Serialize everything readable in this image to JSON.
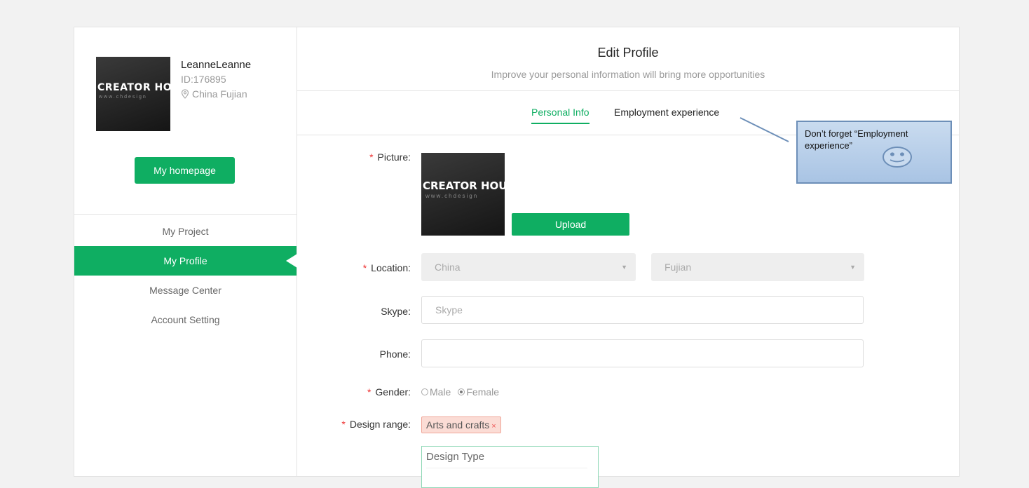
{
  "user": {
    "name": "LeanneLeanne",
    "id": "ID:176895",
    "location": "China Fujian",
    "avatar_brand": "CREATOR HOU",
    "avatar_sub": "www.chdesign"
  },
  "sidebar": {
    "homepage_label": "My homepage",
    "items": [
      {
        "label": "My Project"
      },
      {
        "label": "My Profile"
      },
      {
        "label": "Message Center"
      },
      {
        "label": "Account Setting"
      }
    ]
  },
  "main": {
    "title": "Edit Profile",
    "subtitle": "Improve your personal information will bring more opportunities",
    "tabs": [
      {
        "label": "Personal Info"
      },
      {
        "label": "Employment experience"
      }
    ]
  },
  "form": {
    "picture_label": "Picture:",
    "picture_brand": "CREATOR HOU",
    "picture_sub": "www.chdesign",
    "upload_label": "Upload",
    "location_label": "Location:",
    "country_value": "China",
    "province_value": "Fujian",
    "skype_label": "Skype:",
    "skype_placeholder": "Skype",
    "phone_label": "Phone:",
    "phone_value": "",
    "gender_label": "Gender:",
    "gender_options": [
      "Male",
      "Female"
    ],
    "gender_selected": "Female",
    "design_range_label": "Design range:",
    "design_range_tag": "Arts and crafts",
    "tag_remove": "×",
    "design_type_label": "Design Type",
    "required_mark": "*",
    "caret": "▼"
  },
  "callout": {
    "text_line1": "Don’t forget “Employment",
    "text_line2": "experience”"
  },
  "colors": {
    "accent": "#0fae62",
    "required": "#e33333",
    "callout_bg": "#b8cfe9",
    "callout_border": "#6d8fb8"
  }
}
